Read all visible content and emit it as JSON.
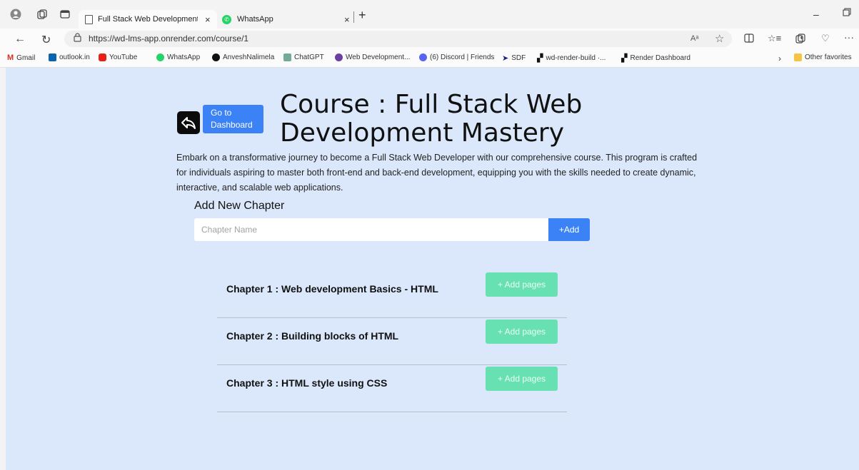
{
  "browser": {
    "tabs": [
      {
        "title": "Full Stack Web Development Ma",
        "active": true
      },
      {
        "title": "WhatsApp",
        "active": false
      }
    ],
    "url": "https://wd-lms-app.onrender.com/course/1",
    "new_tab": "+",
    "bookmarks": [
      "Gmail",
      "outlook.in",
      "YouTube",
      "WhatsApp",
      "AnveshNalimela",
      "ChatGPT",
      "Web Development...",
      "(6) Discord | Friends",
      "SDF",
      "wd-render-build ·...",
      "Render Dashboard"
    ],
    "other_favorites": "Other favorites"
  },
  "page": {
    "dashboard_button": "Go to Dashboard",
    "title": "Course : Full Stack Web Development Mastery",
    "description": "Embark on a transformative journey to become a Full Stack Web Developer with our comprehensive course. This program is crafted for individuals aspiring to master both front-end and back-end development, equipping you with the skills needed to create dynamic, interactive, and scalable web applications.",
    "add_chapter": {
      "heading": "Add New Chapter",
      "placeholder": "Chapter Name",
      "button": "+Add"
    },
    "chapters": [
      {
        "name": "Chapter 1 : Web development Basics - HTML",
        "button": "+ Add pages"
      },
      {
        "name": "Chapter 2 : Building blocks of HTML",
        "button": "+ Add pages"
      },
      {
        "name": "Chapter 3 : HTML style using CSS",
        "button": "+ Add pages"
      }
    ]
  },
  "colors": {
    "page_bg": "#dbe8fb",
    "primary_button": "#3b82f6",
    "add_pages_button": "#67e0b2"
  }
}
